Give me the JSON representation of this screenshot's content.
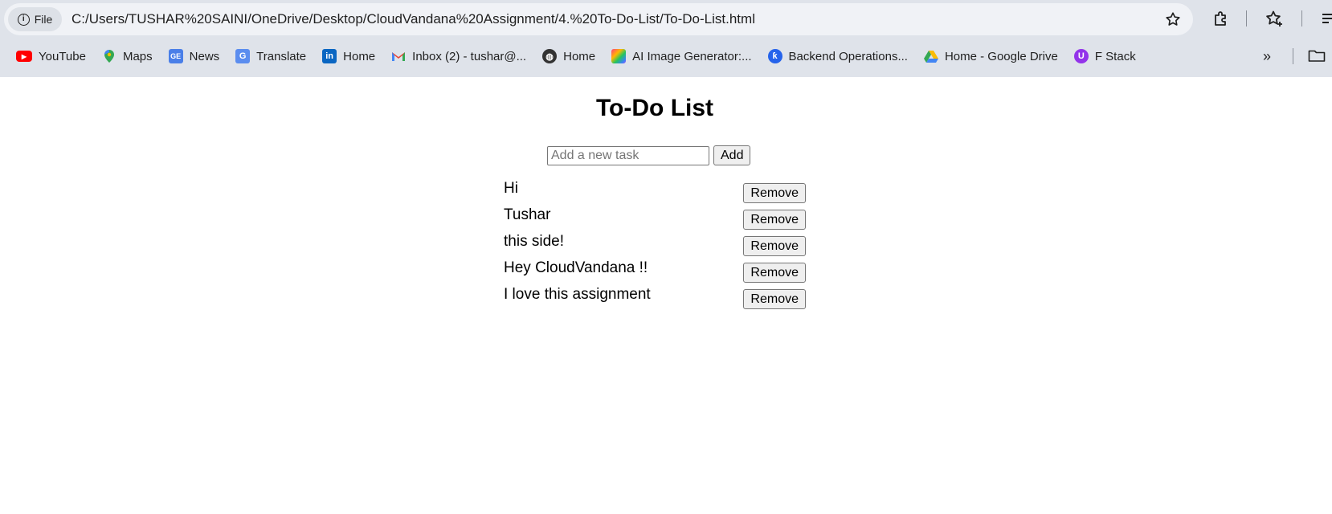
{
  "browser": {
    "protocol_label": "File",
    "url": "C:/Users/TUSHAR%20SAINI/OneDrive/Desktop/CloudVandana%20Assignment/4.%20To-Do-List/To-Do-List.html",
    "bookmarks": [
      {
        "label": "YouTube",
        "icon": "youtube-icon"
      },
      {
        "label": "Maps",
        "icon": "maps-icon"
      },
      {
        "label": "News",
        "icon": "news-icon"
      },
      {
        "label": "Translate",
        "icon": "translate-icon"
      },
      {
        "label": "Home",
        "icon": "linkedin-icon"
      },
      {
        "label": "Inbox (2) - tushar@...",
        "icon": "gmail-icon"
      },
      {
        "label": "Home",
        "icon": "globe-icon"
      },
      {
        "label": "AI Image Generator:...",
        "icon": "ai-image-icon"
      },
      {
        "label": "Backend Operations...",
        "icon": "backend-icon"
      },
      {
        "label": "Home - Google Drive",
        "icon": "drive-icon"
      },
      {
        "label": "F Stack",
        "icon": "fstack-icon"
      }
    ]
  },
  "app": {
    "title": "To-Do List",
    "input_placeholder": "Add a new task",
    "input_value": "",
    "add_label": "Add",
    "remove_label": "Remove",
    "tasks": [
      "Hi",
      "Tushar",
      "this side!",
      "Hey CloudVandana !!",
      "I love this assignment"
    ]
  },
  "colors": {
    "chrome_bg": "#dfe3ea",
    "omnibox_bg": "#f0f2f6",
    "page_bg": "#ffffff"
  }
}
